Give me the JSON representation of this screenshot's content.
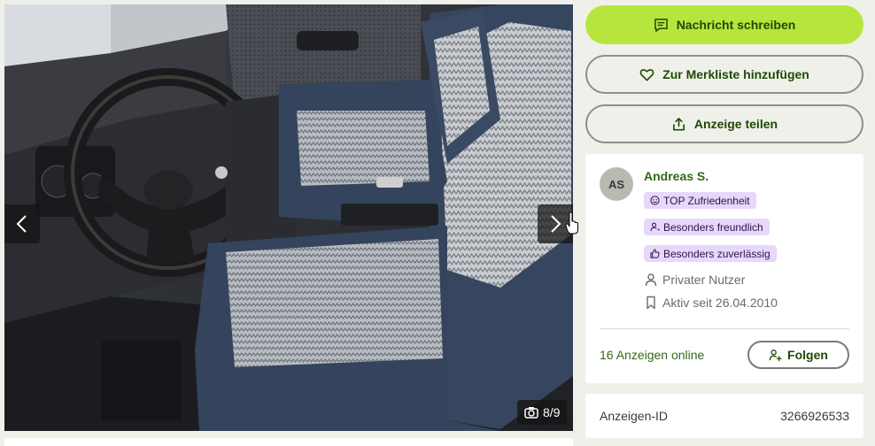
{
  "gallery": {
    "counter_text": "8/9",
    "current_image": 8,
    "total_images": 9,
    "icons": {
      "prev": "chevron-left-icon",
      "next": "chevron-right-icon",
      "counter": "camera-icon"
    }
  },
  "actions": {
    "message_label": "Nachricht schreiben",
    "watchlist_label": "Zur Merkliste hinzufügen",
    "share_label": "Anzeige teilen",
    "icons": {
      "message": "chat-icon",
      "watchlist": "heart-icon",
      "share": "share-icon"
    }
  },
  "seller": {
    "initials": "AS",
    "name": "Andreas S.",
    "badges": [
      {
        "label": "TOP Zufriedenheit",
        "icon": "smiley-icon"
      },
      {
        "label": "Besonders freundlich",
        "icon": "friendly-icon"
      },
      {
        "label": "Besonders zuverlässig",
        "icon": "thumbs-up-icon"
      }
    ],
    "user_type": "Privater Nutzer",
    "active_since": "Aktiv seit 26.04.2010",
    "ads_online": "16 Anzeigen online",
    "follow_label": "Folgen"
  },
  "listing": {
    "id_label": "Anzeigen-ID",
    "id_value": "3266926533"
  },
  "colors": {
    "primary_button": "#b6e63d",
    "primary_text": "#1d4b00",
    "link_green": "#326916",
    "badge_bg": "#e7d7fb",
    "page_bg": "#f0f0eb"
  }
}
